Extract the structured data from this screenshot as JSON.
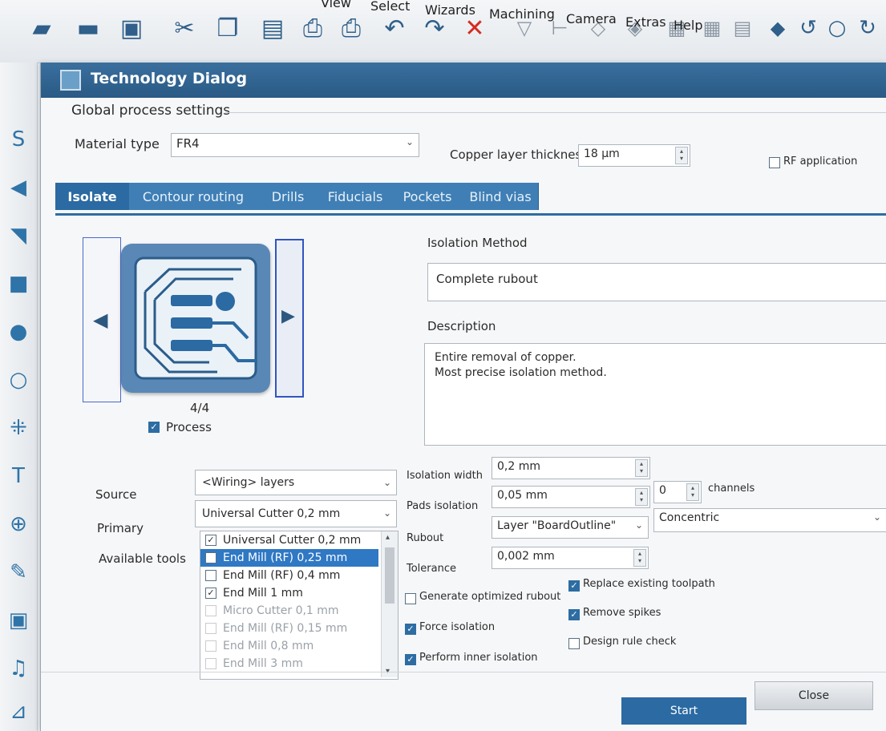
{
  "menu": {
    "items": [
      "View",
      "Select",
      "Wizards",
      "Machining",
      "Camera",
      "Extras",
      "Help"
    ]
  },
  "toolbar_icons": [
    "layer-icon",
    "open-folder-icon",
    "save-icon",
    "cut-icon",
    "copy-icon",
    "paste-icon",
    "print-preview-icon",
    "print-icon",
    "undo-icon",
    "redo-icon",
    "delete-icon",
    "select-icon",
    "measure-icon",
    "move-icon",
    "rotate-icon",
    "align-icon",
    "group-icon",
    "distribute-icon",
    "layout-icon",
    "view-3d-icon",
    "rotate-left-icon",
    "circle-icon",
    "refresh-icon"
  ],
  "dialog": {
    "title": "Technology Dialog",
    "global_settings": {
      "group_label": "Global process settings",
      "material_type_label": "Material type",
      "material_type_value": "FR4",
      "copper_thickness_label": "Copper layer thickness",
      "copper_thickness_value": "18 µm",
      "rf_application_label": "RF application",
      "rf_application_checked": false
    },
    "tabs": [
      "Isolate",
      "Contour routing",
      "Drills",
      "Fiducials",
      "Pockets",
      "Blind vias"
    ],
    "active_tab": "Isolate",
    "preview": {
      "page_indicator": "4/4",
      "process_label": "Process",
      "process_checked": true
    },
    "isolation_method": {
      "label": "Isolation Method",
      "value": "Complete rubout"
    },
    "description": {
      "label": "Description",
      "lines": [
        "Entire removal of copper.",
        "Most precise isolation method."
      ]
    },
    "source": {
      "label": "Source",
      "value": "<Wiring> layers"
    },
    "primary": {
      "label": "Primary",
      "value": "Universal Cutter 0,2 mm"
    },
    "available_tools": {
      "label": "Available tools",
      "items": [
        {
          "label": "Universal Cutter 0,2 mm",
          "checked": true,
          "selected": false,
          "enabled": true
        },
        {
          "label": "End Mill (RF) 0,25 mm",
          "checked": false,
          "selected": true,
          "enabled": true
        },
        {
          "label": "End Mill (RF) 0,4 mm",
          "checked": false,
          "selected": false,
          "enabled": true
        },
        {
          "label": "End Mill 1 mm",
          "checked": true,
          "selected": false,
          "enabled": true
        },
        {
          "label": "Micro Cutter 0,1 mm",
          "checked": false,
          "selected": false,
          "enabled": false
        },
        {
          "label": "End Mill (RF) 0,15 mm",
          "checked": false,
          "selected": false,
          "enabled": false
        },
        {
          "label": "End Mill 0,8 mm",
          "checked": false,
          "selected": false,
          "enabled": false
        },
        {
          "label": "End Mill 3 mm",
          "checked": false,
          "selected": false,
          "enabled": false
        }
      ]
    },
    "isolation_width": {
      "label": "Isolation width",
      "value": "0,2 mm"
    },
    "pads_isolation": {
      "label": "Pads isolation",
      "value": "0,05 mm",
      "channels_value": "0",
      "channels_label": "channels"
    },
    "rubout": {
      "label": "Rubout",
      "value": "Layer \"BoardOutline\"",
      "mode": "Concentric"
    },
    "tolerance": {
      "label": "Tolerance",
      "value": "0,002 mm"
    },
    "options": {
      "generate_optimized_rubout": {
        "label": "Generate optimized rubout",
        "checked": false
      },
      "force_isolation": {
        "label": "Force isolation",
        "checked": true
      },
      "perform_inner_isolation": {
        "label": "Perform inner isolation",
        "checked": true
      },
      "replace_existing_toolpath": {
        "label": "Replace existing toolpath",
        "checked": true
      },
      "remove_spikes": {
        "label": "Remove spikes",
        "checked": true
      },
      "design_rule_check": {
        "label": "Design rule check",
        "checked": false
      }
    },
    "buttons": {
      "start": "Start",
      "close": "Close"
    }
  },
  "colors": {
    "accent": "#2b6aa2",
    "title_bar": "#2a5a85",
    "selection": "#2f78c4",
    "delete_red": "#d62b1f"
  }
}
